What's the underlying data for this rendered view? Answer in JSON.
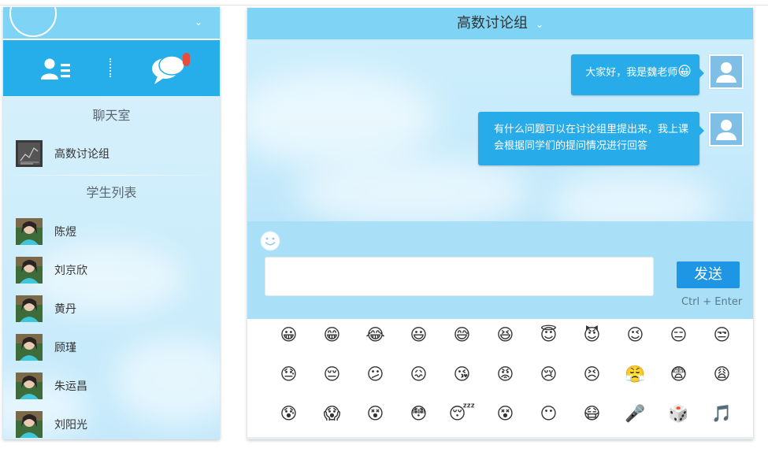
{
  "sidebar": {
    "chatroom_section_title": "聊天室",
    "chatroom": {
      "name": "高数讨论组"
    },
    "students_section_title": "学生列表",
    "students": [
      {
        "name": "陈煜"
      },
      {
        "name": "刘京欣"
      },
      {
        "name": "黄丹"
      },
      {
        "name": "顾瑾"
      },
      {
        "name": "朱运昌"
      },
      {
        "name": "刘阳光"
      }
    ]
  },
  "chat": {
    "title": "高数讨论组",
    "messages": [
      {
        "text": "大家好，我是魏老师",
        "emoji": "😀"
      },
      {
        "line1": "有什么问题可以在讨论组里提出来，我上课",
        "line2": "会根据同学们的提问情况进行回答"
      }
    ],
    "input_value": "",
    "send_label": "发送",
    "send_hint": "Ctrl + Enter"
  },
  "emoji_grid": [
    "😀",
    "😁",
    "😂",
    "😃",
    "😅",
    "😆",
    "😇",
    "😈",
    "😉",
    "😑",
    "😒",
    "😓",
    "😔",
    "😕",
    "😖",
    "😘",
    "😡",
    "😢",
    "😣",
    "😤",
    "😨",
    "😩",
    "😰",
    "😱",
    "😵",
    "😳",
    "😴",
    "😵",
    "😶",
    "😷",
    "🎤",
    "🎲",
    "🎵"
  ],
  "colors": {
    "header_bg": "#7fd3f4",
    "accent": "#26aeea",
    "bubble": "#27ace9",
    "send_button": "#1f96e3",
    "unread_badge": "#e74c3c"
  }
}
